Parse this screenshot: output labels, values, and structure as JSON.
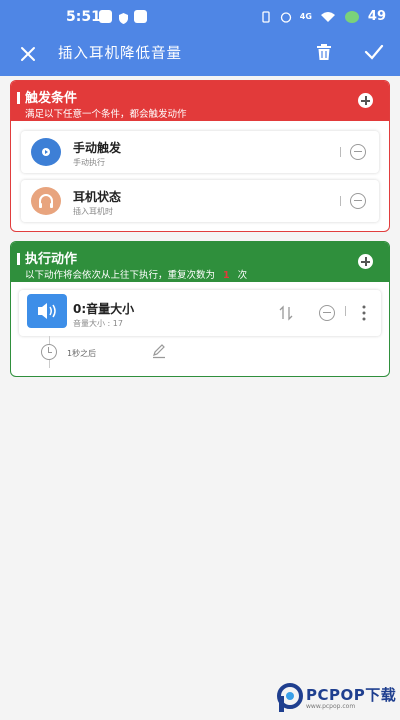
{
  "status": {
    "time": "5:51",
    "battery": "49",
    "network": "4G"
  },
  "appbar": {
    "title": "插入耳机降低音量"
  },
  "trigger_section": {
    "title": "触发条件",
    "subtitle": "满足以下任意一个条件，都会触发动作",
    "cards": [
      {
        "name": "手动触发",
        "desc": "手动执行",
        "icon": "play-icon",
        "color": "#3d7fd6"
      },
      {
        "name": "耳机状态",
        "desc": "插入耳机时",
        "icon": "headphones-icon",
        "color": "#e8a47e"
      }
    ]
  },
  "action_section": {
    "title": "执行动作",
    "subtitle_before": "以下动作将会依次从上往下执行，重复次数为",
    "repeat": "1",
    "subtitle_after": "次",
    "action": {
      "name": "0:音量大小",
      "desc": "音量大小 : 17",
      "icon": "speaker-icon"
    },
    "delay": "1秒之后"
  },
  "watermark": {
    "brand": "PCPOP下载",
    "sub": "www.pcpop.com"
  },
  "colors": {
    "appbar": "#4f86e5",
    "trigger": "#e23a3a",
    "action": "#2f8f3c"
  }
}
